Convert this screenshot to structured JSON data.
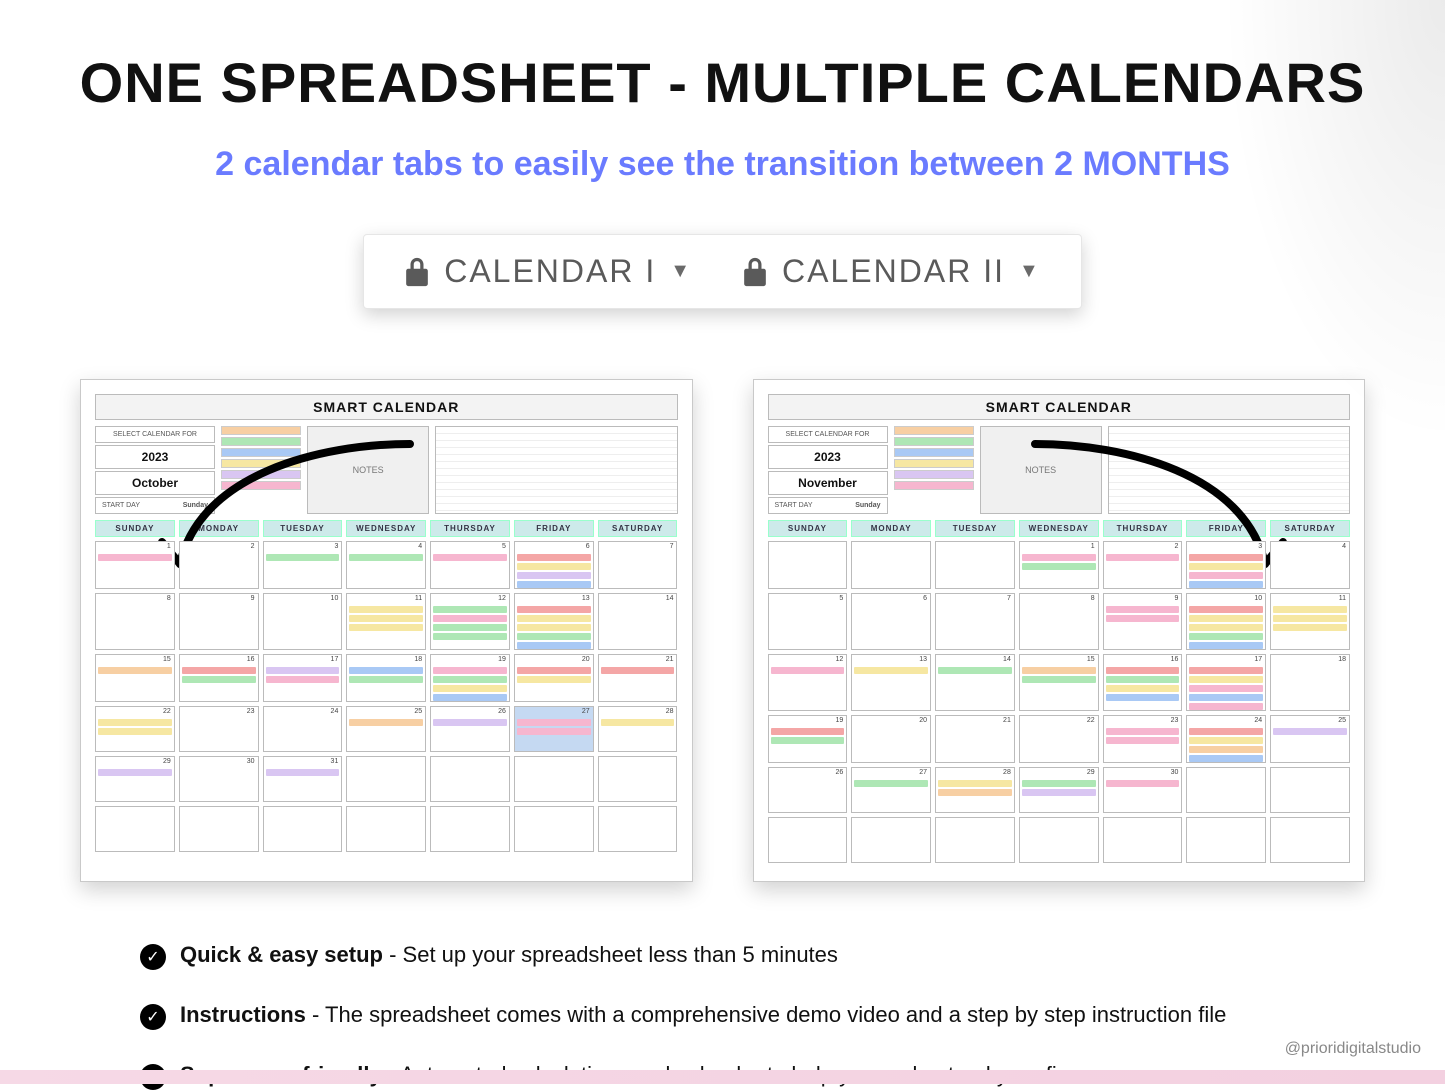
{
  "title": "ONE SPREADSHEET - MULTIPLE CALENDARS",
  "subtitle": "2 calendar tabs to easily see the transition between 2 MONTHS",
  "tabs": {
    "tab1": "CALENDAR I",
    "tab2": "CALENDAR II"
  },
  "calendar_header": "SMART CALENDAR",
  "notes_label": "NOTES",
  "fields": {
    "year": "2023",
    "start_day_label": "START DAY",
    "start_day_value": "Sunday",
    "select_label": "SELECT CALENDAR FOR"
  },
  "months": {
    "left": "October",
    "right": "November"
  },
  "day_headers": [
    "SUNDAY",
    "MONDAY",
    "TUESDAY",
    "WEDNESDAY",
    "THURSDAY",
    "FRIDAY",
    "SATURDAY"
  ],
  "legend_colors": [
    "#f7cfa3",
    "#aee7b5",
    "#a9c9f5",
    "#f6e7a2",
    "#d9c6f2",
    "#f6b6cf"
  ],
  "left_cells": [
    {
      "n": "1",
      "chips": [
        "c-pink"
      ]
    },
    {
      "n": "2"
    },
    {
      "n": "3",
      "chips": [
        "c-green"
      ]
    },
    {
      "n": "4",
      "chips": [
        "c-green"
      ]
    },
    {
      "n": "5",
      "chips": [
        "c-pink"
      ]
    },
    {
      "n": "6",
      "chips": [
        "c-red",
        "c-yellow",
        "c-purple",
        "c-blue"
      ]
    },
    {
      "n": "7"
    },
    {
      "n": "8"
    },
    {
      "n": "9"
    },
    {
      "n": "10"
    },
    {
      "n": "11",
      "chips": [
        "c-yellow",
        "c-yellow",
        "c-yellow"
      ]
    },
    {
      "n": "12",
      "chips": [
        "c-green",
        "c-pink",
        "c-green",
        "c-green"
      ]
    },
    {
      "n": "13",
      "chips": [
        "c-red",
        "c-yellow",
        "c-yellow",
        "c-green",
        "c-blue"
      ]
    },
    {
      "n": "14"
    },
    {
      "n": "15",
      "chips": [
        "c-orange"
      ]
    },
    {
      "n": "16",
      "chips": [
        "c-red",
        "c-green"
      ]
    },
    {
      "n": "17",
      "chips": [
        "c-purple",
        "c-pink"
      ]
    },
    {
      "n": "18",
      "chips": [
        "c-blue",
        "c-green"
      ]
    },
    {
      "n": "19",
      "chips": [
        "c-pink",
        "c-green",
        "c-yellow",
        "c-blue"
      ]
    },
    {
      "n": "20",
      "chips": [
        "c-red",
        "c-yellow"
      ]
    },
    {
      "n": "21",
      "chips": [
        "c-red"
      ]
    },
    {
      "n": "22",
      "chips": [
        "c-yellow",
        "c-yellow"
      ]
    },
    {
      "n": "23"
    },
    {
      "n": "24"
    },
    {
      "n": "25",
      "chips": [
        "c-orange"
      ]
    },
    {
      "n": "26",
      "chips": [
        "c-purple"
      ]
    },
    {
      "n": "27",
      "blue": true,
      "chips": [
        "c-pink",
        "c-pink"
      ]
    },
    {
      "n": "28",
      "chips": [
        "c-yellow"
      ]
    },
    {
      "n": "29",
      "chips": [
        "c-purple"
      ]
    },
    {
      "n": "30"
    },
    {
      "n": "31",
      "chips": [
        "c-purple"
      ]
    },
    {
      "n": ""
    },
    {
      "n": ""
    },
    {
      "n": ""
    },
    {
      "n": ""
    },
    {
      "n": ""
    },
    {
      "n": ""
    },
    {
      "n": ""
    },
    {
      "n": ""
    },
    {
      "n": ""
    },
    {
      "n": ""
    },
    {
      "n": ""
    }
  ],
  "right_cells": [
    {
      "n": ""
    },
    {
      "n": ""
    },
    {
      "n": ""
    },
    {
      "n": "1",
      "chips": [
        "c-pink",
        "c-green"
      ]
    },
    {
      "n": "2",
      "chips": [
        "c-pink"
      ]
    },
    {
      "n": "3",
      "chips": [
        "c-red",
        "c-yellow",
        "c-pink",
        "c-blue"
      ]
    },
    {
      "n": "4"
    },
    {
      "n": "5"
    },
    {
      "n": "6"
    },
    {
      "n": "7"
    },
    {
      "n": "8"
    },
    {
      "n": "9",
      "chips": [
        "c-pink",
        "c-pink"
      ]
    },
    {
      "n": "10",
      "chips": [
        "c-red",
        "c-yellow",
        "c-yellow",
        "c-green",
        "c-blue"
      ]
    },
    {
      "n": "11",
      "chips": [
        "c-yellow",
        "c-yellow",
        "c-yellow"
      ]
    },
    {
      "n": "12",
      "chips": [
        "c-pink"
      ]
    },
    {
      "n": "13",
      "chips": [
        "c-yellow"
      ]
    },
    {
      "n": "14",
      "chips": [
        "c-green"
      ]
    },
    {
      "n": "15",
      "chips": [
        "c-orange",
        "c-green"
      ]
    },
    {
      "n": "16",
      "chips": [
        "c-red",
        "c-green",
        "c-yellow",
        "c-blue"
      ]
    },
    {
      "n": "17",
      "chips": [
        "c-red",
        "c-yellow",
        "c-pink",
        "c-blue",
        "c-pink"
      ]
    },
    {
      "n": "18"
    },
    {
      "n": "19",
      "chips": [
        "c-red",
        "c-green"
      ]
    },
    {
      "n": "20"
    },
    {
      "n": "21"
    },
    {
      "n": "22"
    },
    {
      "n": "23",
      "chips": [
        "c-pink",
        "c-pink"
      ]
    },
    {
      "n": "24",
      "chips": [
        "c-red",
        "c-yellow",
        "c-orange",
        "c-blue"
      ]
    },
    {
      "n": "25",
      "chips": [
        "c-purple"
      ]
    },
    {
      "n": "26"
    },
    {
      "n": "27",
      "chips": [
        "c-green"
      ]
    },
    {
      "n": "28",
      "chips": [
        "c-yellow",
        "c-orange"
      ]
    },
    {
      "n": "29",
      "chips": [
        "c-green",
        "c-purple"
      ]
    },
    {
      "n": "30",
      "chips": [
        "c-pink"
      ]
    },
    {
      "n": ""
    },
    {
      "n": ""
    },
    {
      "n": ""
    },
    {
      "n": ""
    },
    {
      "n": ""
    },
    {
      "n": ""
    },
    {
      "n": ""
    },
    {
      "n": ""
    },
    {
      "n": ""
    }
  ],
  "bullets": [
    {
      "bold": "Quick & easy setup",
      "rest": " - Set up your spreadsheet less than 5 minutes"
    },
    {
      "bold": "Instructions",
      "rest": " - The spreadsheet comes with a comprehensive demo video and a step by step instruction file"
    },
    {
      "bold": "Super user-friendly",
      "rest": " - Automated calculations and calendar to help you understand your finances"
    }
  ],
  "handle": "@prioridigitalstudio"
}
